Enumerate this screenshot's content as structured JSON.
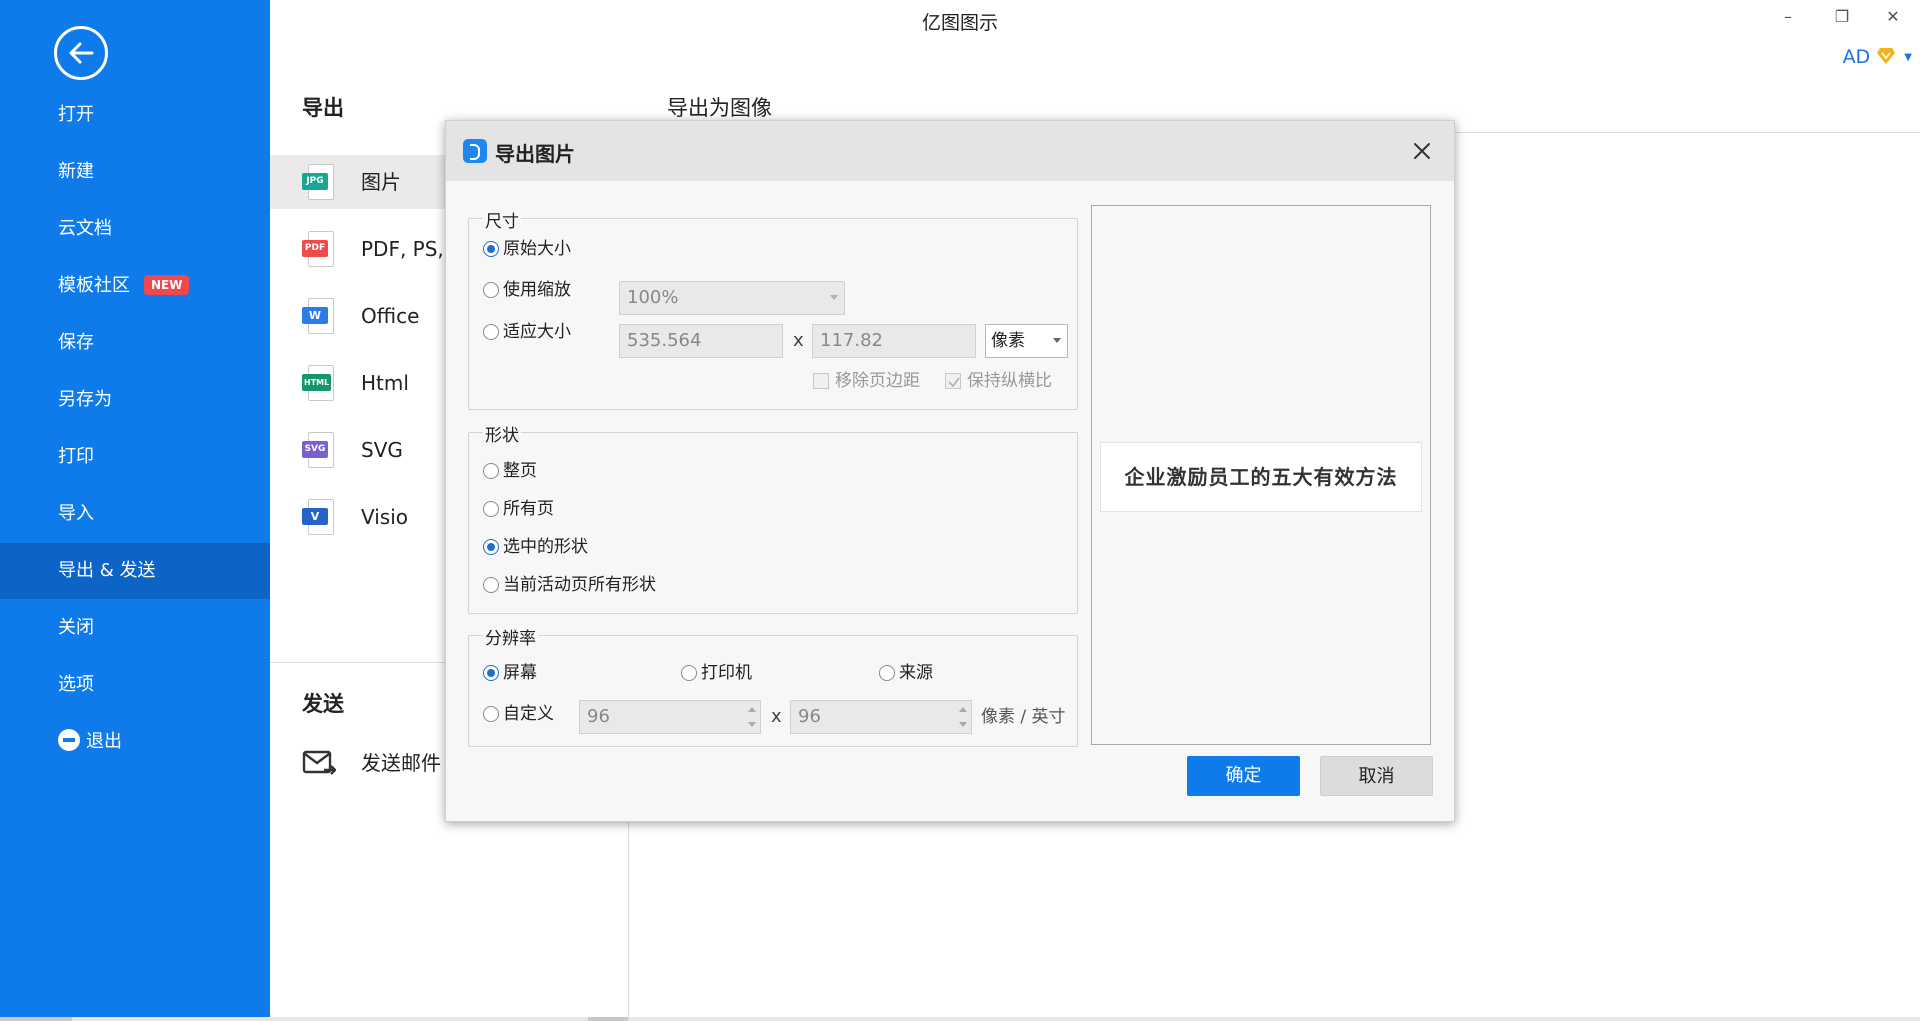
{
  "app": {
    "title": "亿图图示"
  },
  "window": {
    "minimize": "–",
    "restore": "❐",
    "close": "✕"
  },
  "user": {
    "initials": "AD"
  },
  "sidebar": {
    "items": [
      {
        "label": "打开"
      },
      {
        "label": "新建"
      },
      {
        "label": "云文档"
      },
      {
        "label": "模板社区",
        "badge": "NEW"
      },
      {
        "label": "保存"
      },
      {
        "label": "另存为"
      },
      {
        "label": "打印"
      },
      {
        "label": "导入"
      },
      {
        "label": "导出 & 发送"
      },
      {
        "label": "关闭"
      },
      {
        "label": "选项"
      },
      {
        "label": "退出"
      }
    ]
  },
  "export": {
    "heading": "导出",
    "subheading": "导出为图像",
    "items": [
      {
        "label": "图片",
        "tag": "JPG",
        "color": "#1aa597"
      },
      {
        "label": "PDF, PS, EPS",
        "tag": "PDF",
        "color": "#ee4b4b"
      },
      {
        "label": "Office",
        "tag": "W",
        "color": "#2b7ce9"
      },
      {
        "label": "Html",
        "tag": "HTML",
        "color": "#16966b"
      },
      {
        "label": "SVG",
        "tag": "SVG",
        "color": "#7a5fd1"
      },
      {
        "label": "Visio",
        "tag": "V",
        "color": "#2563c9"
      }
    ]
  },
  "send": {
    "heading": "发送",
    "mail_label": "发送邮件"
  },
  "dialog": {
    "title": "导出图片",
    "size": {
      "legend": "尺寸",
      "original": "原始大小",
      "use_zoom": "使用缩放",
      "zoom_value": "100%",
      "fit_size": "适应大小",
      "width": "535.564",
      "height": "117.82",
      "times": "x",
      "unit": "像素",
      "remove_margin": "移除页边距",
      "keep_ratio": "保持纵横比"
    },
    "shape": {
      "legend": "形状",
      "whole_page": "整页",
      "all_pages": "所有页",
      "selected_shapes": "选中的形状",
      "active_page_shapes": "当前活动页所有形状"
    },
    "resolution": {
      "legend": "分辨率",
      "screen": "屏幕",
      "printer": "打印机",
      "source": "来源",
      "custom": "自定义",
      "dpi_x": "96",
      "dpi_y": "96",
      "times": "x",
      "unit": "像素 / 英寸"
    },
    "preview_text": "企业激励员工的五大有效方法",
    "ok": "确定",
    "cancel": "取消"
  },
  "colors": {
    "accent": "#0f7bea",
    "sidebar_active": "#0c64c7",
    "badge": "#f0484f"
  }
}
